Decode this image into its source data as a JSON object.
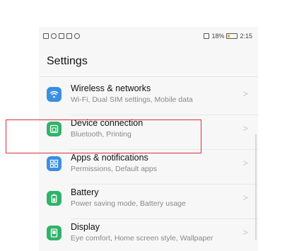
{
  "status_bar": {
    "battery_percent": "18%",
    "time": "2:15"
  },
  "header": {
    "title": "Settings"
  },
  "settings_items": [
    {
      "title": "Wireless & networks",
      "subtitle": "Wi-Fi, Dual SIM settings, Mobile data",
      "icon": "wifi-icon",
      "color": "#3a8fe0"
    },
    {
      "title": "Device connection",
      "subtitle": "Bluetooth, Printing",
      "icon": "device-connection-icon",
      "color": "#2fb36a"
    },
    {
      "title": "Apps & notifications",
      "subtitle": "Permissions, Default apps",
      "icon": "apps-grid-icon",
      "color": "#3a8fe0"
    },
    {
      "title": "Battery",
      "subtitle": "Power saving mode, Battery usage",
      "icon": "battery-icon",
      "color": "#2fb36a"
    },
    {
      "title": "Display",
      "subtitle": "Eye comfort, Home screen style, Wallpaper",
      "icon": "display-icon",
      "color": "#2fb36a"
    }
  ],
  "highlight_color": "#d8303a"
}
